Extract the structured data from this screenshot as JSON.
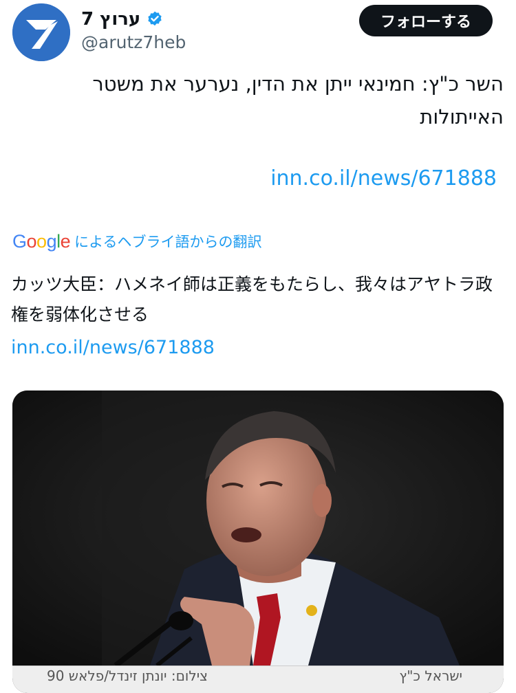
{
  "profile": {
    "display_name": "ערוץ 7",
    "handle": "@arutz7heb",
    "avatar_icon": "arutz7-logo",
    "verified_icon": "verified-badge-icon",
    "verified_color": "#1d9bf0",
    "follow_label": "フォローする"
  },
  "tweet": {
    "text": "השר כ\"ץ: חמינאי ייתן את הדין, נערער את משטר האייתולות",
    "link": "inn.co.il/news/671888"
  },
  "translation": {
    "google_letters": [
      "G",
      "o",
      "o",
      "g",
      "l",
      "e"
    ],
    "label": "によるヘブライ語からの翻訳",
    "text": "カッツ大臣：ハメネイ師は正義をもたらし、我々はアヤトラ政権を弱体化させる",
    "link": "inn.co.il/news/671888"
  },
  "media": {
    "description_icon": "photo-of-speaker",
    "caption_right": "ישראל כ\"ץ",
    "caption_left": "צילום: יונתן זינדל/פלאש 90"
  },
  "colors": {
    "text": "#0f1419",
    "secondary": "#536471",
    "link": "#1d9bf0",
    "follow_bg": "#0f1419"
  }
}
